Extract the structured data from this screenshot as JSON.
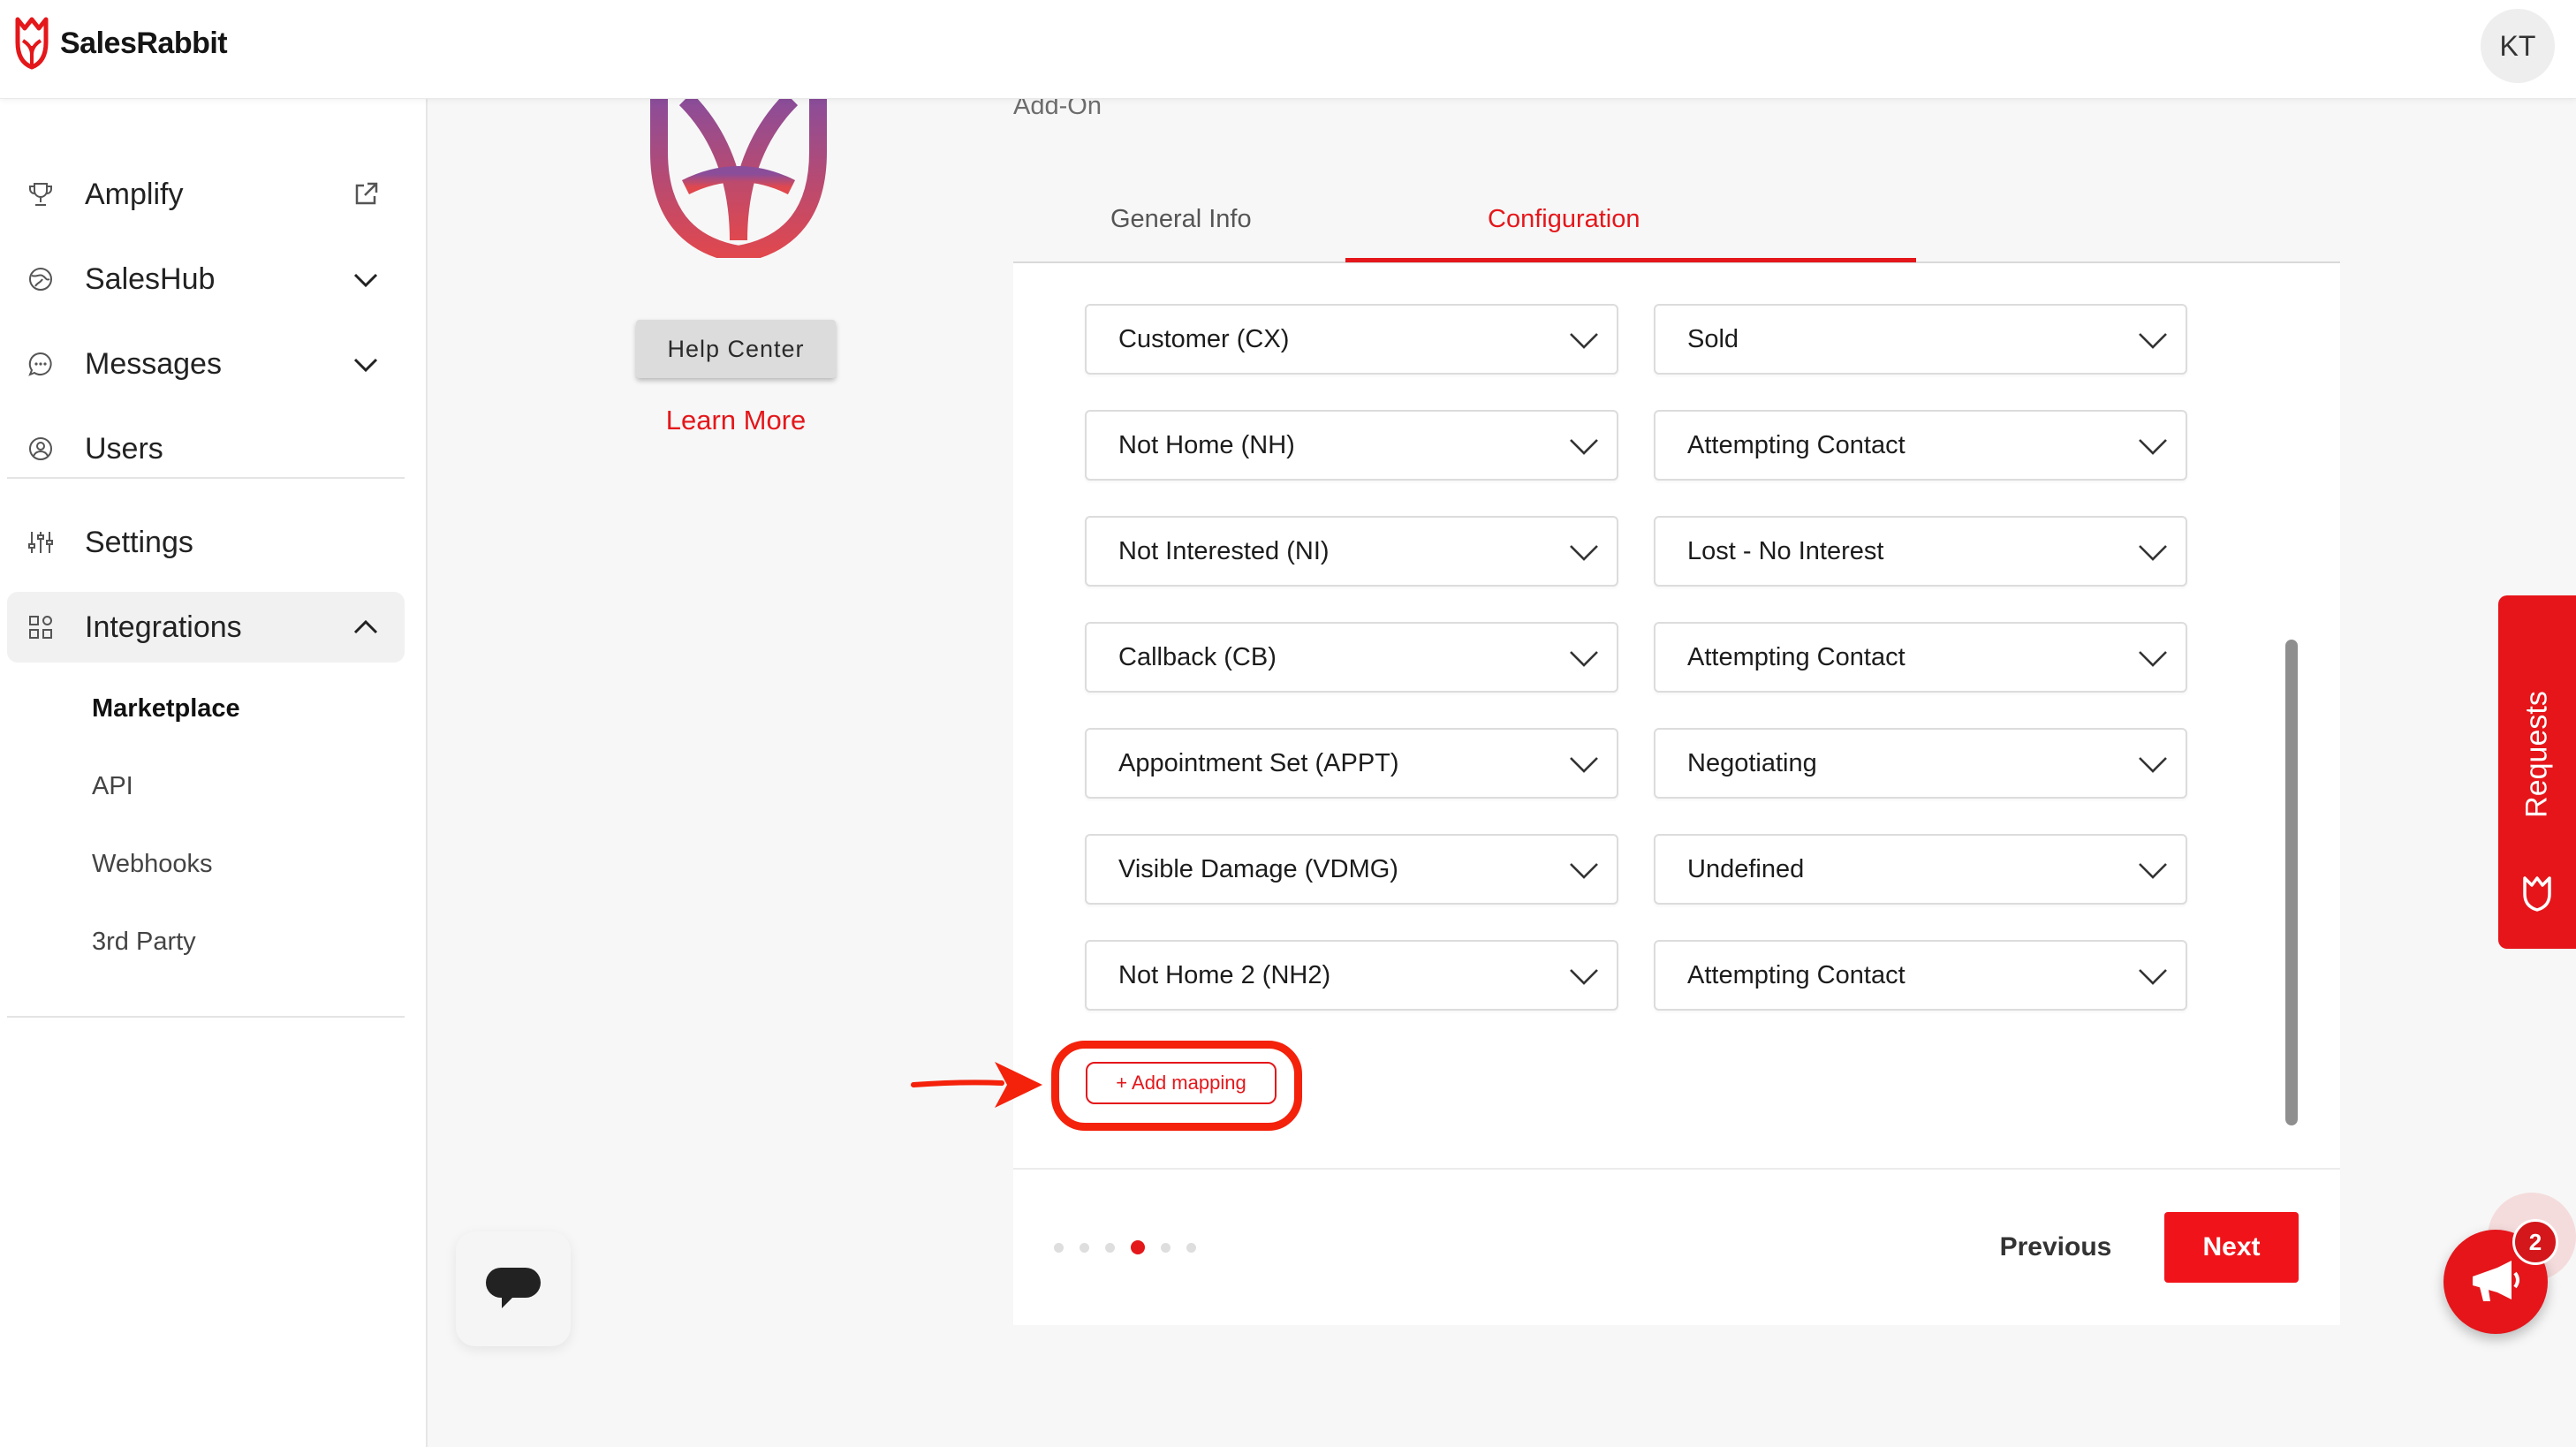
{
  "app": {
    "name": "SalesRabbit",
    "user_initials": "KT",
    "brand_color": "#e4171b"
  },
  "sidebar": {
    "items": [
      {
        "label": "Amplify",
        "icon": "trophy-icon",
        "trailing": "external-link-icon"
      },
      {
        "label": "SalesHub",
        "icon": "globe-icon",
        "trailing": "chevron-down-icon"
      },
      {
        "label": "Messages",
        "icon": "chat-icon",
        "trailing": "chevron-down-icon"
      },
      {
        "label": "Users",
        "icon": "user-circle-icon"
      },
      {
        "label": "Settings",
        "icon": "sliders-icon"
      },
      {
        "label": "Integrations",
        "icon": "grid-icon",
        "trailing": "chevron-up-icon",
        "expanded": true
      }
    ],
    "integrations_sub": [
      "Marketplace",
      "API",
      "Webhooks",
      "3rd Party"
    ],
    "active_sub": "Marketplace"
  },
  "integration": {
    "type_label": "Add-On",
    "help_button": "Help Center",
    "learn_more": "Learn More"
  },
  "tabs": [
    {
      "label": "General Info",
      "active": false
    },
    {
      "label": "Configuration",
      "active": true
    }
  ],
  "mappings": [
    {
      "source": "Customer (CX)",
      "target": "Sold"
    },
    {
      "source": "Not Home (NH)",
      "target": "Attempting Contact"
    },
    {
      "source": "Not Interested (NI)",
      "target": "Lost - No Interest"
    },
    {
      "source": "Callback (CB)",
      "target": "Attempting Contact"
    },
    {
      "source": "Appointment Set (APPT)",
      "target": "Negotiating"
    },
    {
      "source": "Visible Damage (VDMG)",
      "target": "Undefined"
    },
    {
      "source": "Not Home 2 (NH2)",
      "target": "Attempting Contact"
    }
  ],
  "add_mapping_label": "+ Add mapping",
  "wizard": {
    "total_steps": 6,
    "current_step": 4,
    "previous_label": "Previous",
    "next_label": "Next"
  },
  "requests_tab": "Requests",
  "notification_count": "2"
}
